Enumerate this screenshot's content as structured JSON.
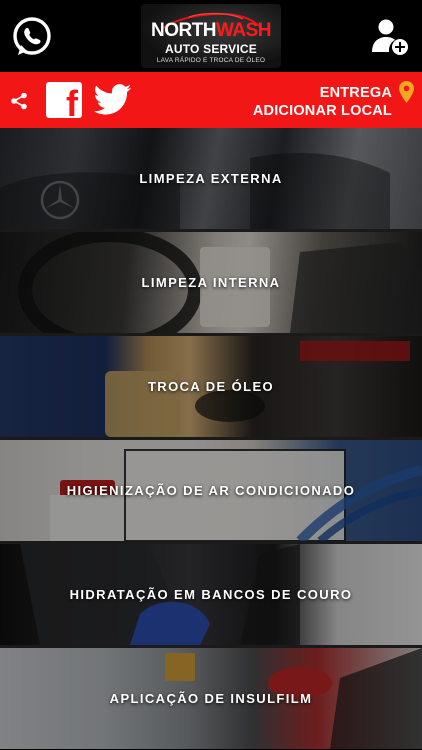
{
  "header": {
    "logo": {
      "north": "NORTH",
      "wash": "WASH",
      "subtitle": "AUTO SERVICE",
      "tagline": "LAVA RÁPIDO E TROCA DE ÓLEO"
    },
    "left_icon": "whatsapp-icon",
    "right_icon": "add-user-icon"
  },
  "action_bar": {
    "background": "#f21616",
    "icons": [
      "share-icon",
      "facebook-icon",
      "twitter-icon"
    ],
    "location_line1": "ENTREGA",
    "location_line2": "ADICIONAR LOCAL",
    "pin_color": "#f5a623"
  },
  "services": [
    {
      "label": "LIMPEZA EXTERNA"
    },
    {
      "label": "LIMPEZA INTERNA"
    },
    {
      "label": "TROCA DE ÓLEO"
    },
    {
      "label": "HIGIENIZAÇÃO DE AR CONDICIONADO"
    },
    {
      "label": "HIDRATAÇÃO EM BANCOS DE COURO"
    },
    {
      "label": "APLICAÇÃO DE INSULFILM"
    }
  ]
}
